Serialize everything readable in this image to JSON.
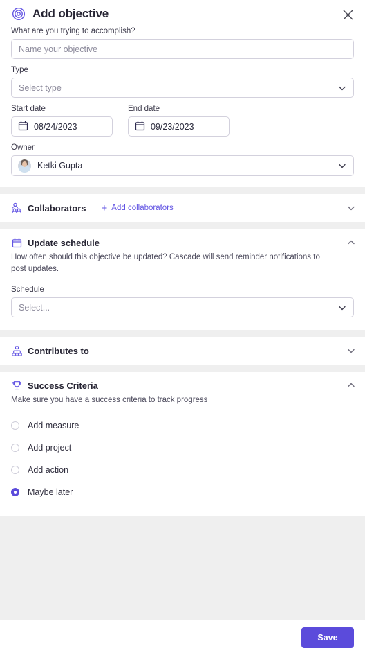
{
  "header": {
    "title": "Add objective",
    "icon": "target-icon",
    "close_icon": "close-icon"
  },
  "form": {
    "name_label": "What are you trying to accomplish?",
    "name_placeholder": "Name your objective",
    "name_value": "",
    "type_label": "Type",
    "type_placeholder": "Select type",
    "start_date_label": "Start date",
    "start_date_value": "08/24/2023",
    "end_date_label": "End date",
    "end_date_value": "09/23/2023",
    "owner_label": "Owner",
    "owner_name": "Ketki Gupta"
  },
  "sections": {
    "collaborators": {
      "title": "Collaborators",
      "icon": "people-icon",
      "add_label": "Add collaborators",
      "expanded": false,
      "chevron": "chevron-down-icon"
    },
    "update_schedule": {
      "title": "Update schedule",
      "icon": "calendar-icon",
      "description": "How often should this objective be updated? Cascade will send reminder notifications to post updates.",
      "schedule_label": "Schedule",
      "schedule_placeholder": "Select...",
      "expanded": true,
      "chevron": "chevron-up-icon"
    },
    "contributes_to": {
      "title": "Contributes to",
      "icon": "hierarchy-icon",
      "expanded": false,
      "chevron": "chevron-down-icon"
    },
    "success_criteria": {
      "title": "Success Criteria",
      "icon": "trophy-icon",
      "description": "Make sure you have a success criteria to track progress",
      "expanded": true,
      "chevron": "chevron-up-icon",
      "options": [
        {
          "label": "Add measure",
          "selected": false
        },
        {
          "label": "Add project",
          "selected": false
        },
        {
          "label": "Add action",
          "selected": false
        },
        {
          "label": "Maybe later",
          "selected": true
        }
      ]
    }
  },
  "footer": {
    "save_label": "Save"
  },
  "colors": {
    "accent": "#5b4bdb",
    "icon_purple": "#6254e3",
    "panel_bg": "#efefef",
    "card_bg": "#ffffff",
    "border": "#d3d1dd",
    "text": "#2b2b3d",
    "placeholder": "#8d8b9c"
  }
}
